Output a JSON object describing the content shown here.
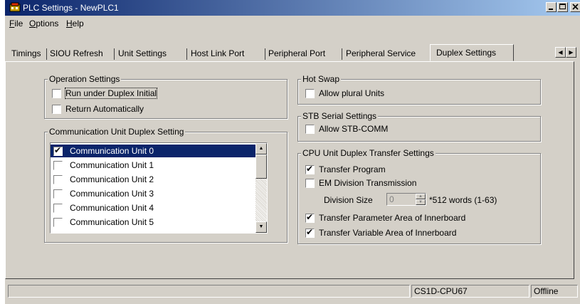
{
  "window": {
    "title": "PLC Settings - NewPLC1"
  },
  "menu": [
    {
      "label": "File"
    },
    {
      "label": "Options"
    },
    {
      "label": "Help"
    }
  ],
  "tabs": [
    {
      "label": "Timings"
    },
    {
      "label": "SIOU Refresh"
    },
    {
      "label": "Unit Settings"
    },
    {
      "label": "Host Link Port"
    },
    {
      "label": "Peripheral Port"
    },
    {
      "label": "Peripheral Service"
    },
    {
      "label": "Duplex Settings",
      "active": true
    }
  ],
  "operation_settings": {
    "title": "Operation Settings",
    "options": [
      {
        "label": "Run under Duplex Initial",
        "checked": false
      },
      {
        "label": "Return Automatically",
        "checked": false
      }
    ]
  },
  "comm_duplex": {
    "title": "Communication Unit Duplex Setting",
    "items": [
      {
        "label": "Communication Unit 0",
        "checked": true,
        "selected": true
      },
      {
        "label": "Communication Unit 1",
        "checked": false
      },
      {
        "label": "Communication Unit 2",
        "checked": false
      },
      {
        "label": "Communication Unit 3",
        "checked": false
      },
      {
        "label": "Communication Unit 4",
        "checked": false
      },
      {
        "label": "Communication Unit 5",
        "checked": false
      }
    ]
  },
  "hot_swap": {
    "title": "Hot Swap",
    "options": [
      {
        "label": "Allow plural Units",
        "checked": false
      }
    ]
  },
  "stb_serial": {
    "title": "STB Serial Settings",
    "options": [
      {
        "label": "Allow STB-COMM",
        "checked": false
      }
    ]
  },
  "cpu_transfer": {
    "title": "CPU Unit Duplex Transfer Settings",
    "options": [
      {
        "label": "Transfer Program",
        "checked": true
      },
      {
        "label": "EM Division Transmission",
        "checked": false
      }
    ],
    "division_size": {
      "label": "Division Size",
      "value": "0",
      "suffix": "*512 words (1-63)"
    },
    "options2": [
      {
        "label": "Transfer Parameter Area of Innerboard",
        "checked": true
      },
      {
        "label": "Transfer Variable Area of Innerboard",
        "checked": true
      }
    ]
  },
  "status": {
    "model": "CS1D-CPU67",
    "mode": "Offline"
  }
}
